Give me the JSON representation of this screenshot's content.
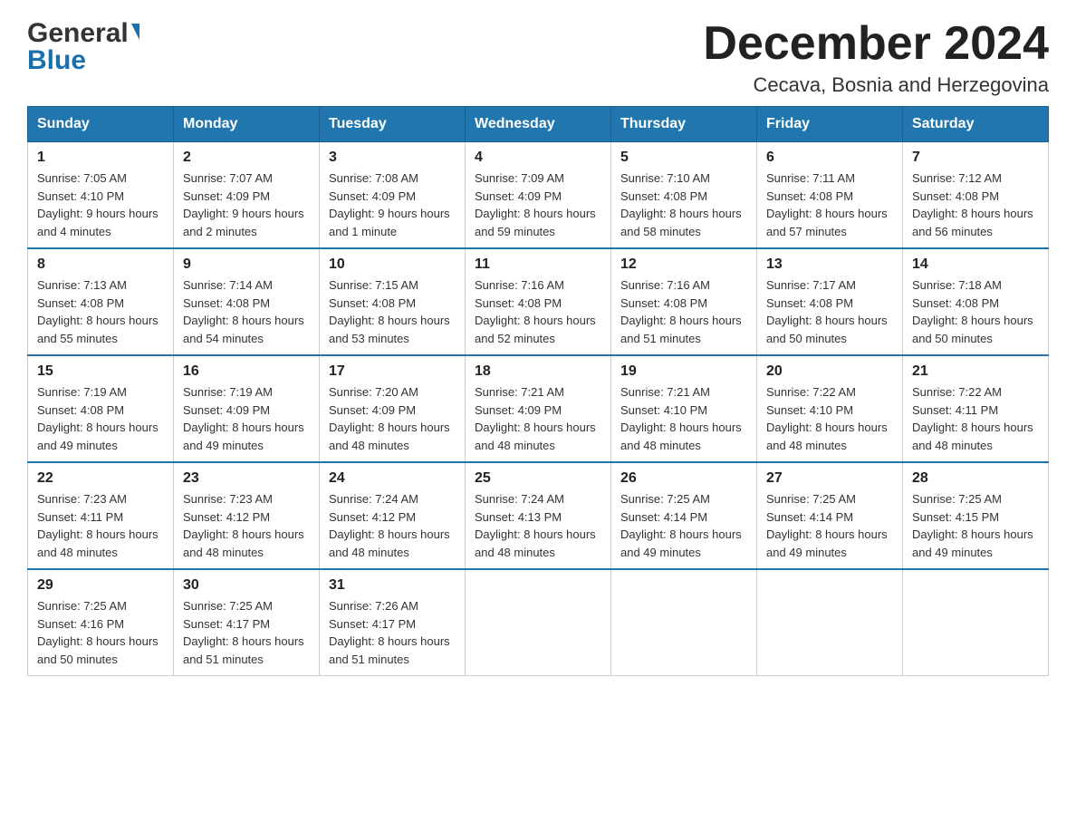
{
  "logo": {
    "general": "General",
    "blue": "Blue"
  },
  "title": {
    "month_year": "December 2024",
    "location": "Cecava, Bosnia and Herzegovina"
  },
  "weekdays": [
    "Sunday",
    "Monday",
    "Tuesday",
    "Wednesday",
    "Thursday",
    "Friday",
    "Saturday"
  ],
  "weeks": [
    [
      {
        "day": "1",
        "sunrise": "7:05 AM",
        "sunset": "4:10 PM",
        "daylight": "9 hours and 4 minutes."
      },
      {
        "day": "2",
        "sunrise": "7:07 AM",
        "sunset": "4:09 PM",
        "daylight": "9 hours and 2 minutes."
      },
      {
        "day": "3",
        "sunrise": "7:08 AM",
        "sunset": "4:09 PM",
        "daylight": "9 hours and 1 minute."
      },
      {
        "day": "4",
        "sunrise": "7:09 AM",
        "sunset": "4:09 PM",
        "daylight": "8 hours and 59 minutes."
      },
      {
        "day": "5",
        "sunrise": "7:10 AM",
        "sunset": "4:08 PM",
        "daylight": "8 hours and 58 minutes."
      },
      {
        "day": "6",
        "sunrise": "7:11 AM",
        "sunset": "4:08 PM",
        "daylight": "8 hours and 57 minutes."
      },
      {
        "day": "7",
        "sunrise": "7:12 AM",
        "sunset": "4:08 PM",
        "daylight": "8 hours and 56 minutes."
      }
    ],
    [
      {
        "day": "8",
        "sunrise": "7:13 AM",
        "sunset": "4:08 PM",
        "daylight": "8 hours and 55 minutes."
      },
      {
        "day": "9",
        "sunrise": "7:14 AM",
        "sunset": "4:08 PM",
        "daylight": "8 hours and 54 minutes."
      },
      {
        "day": "10",
        "sunrise": "7:15 AM",
        "sunset": "4:08 PM",
        "daylight": "8 hours and 53 minutes."
      },
      {
        "day": "11",
        "sunrise": "7:16 AM",
        "sunset": "4:08 PM",
        "daylight": "8 hours and 52 minutes."
      },
      {
        "day": "12",
        "sunrise": "7:16 AM",
        "sunset": "4:08 PM",
        "daylight": "8 hours and 51 minutes."
      },
      {
        "day": "13",
        "sunrise": "7:17 AM",
        "sunset": "4:08 PM",
        "daylight": "8 hours and 50 minutes."
      },
      {
        "day": "14",
        "sunrise": "7:18 AM",
        "sunset": "4:08 PM",
        "daylight": "8 hours and 50 minutes."
      }
    ],
    [
      {
        "day": "15",
        "sunrise": "7:19 AM",
        "sunset": "4:08 PM",
        "daylight": "8 hours and 49 minutes."
      },
      {
        "day": "16",
        "sunrise": "7:19 AM",
        "sunset": "4:09 PM",
        "daylight": "8 hours and 49 minutes."
      },
      {
        "day": "17",
        "sunrise": "7:20 AM",
        "sunset": "4:09 PM",
        "daylight": "8 hours and 48 minutes."
      },
      {
        "day": "18",
        "sunrise": "7:21 AM",
        "sunset": "4:09 PM",
        "daylight": "8 hours and 48 minutes."
      },
      {
        "day": "19",
        "sunrise": "7:21 AM",
        "sunset": "4:10 PM",
        "daylight": "8 hours and 48 minutes."
      },
      {
        "day": "20",
        "sunrise": "7:22 AM",
        "sunset": "4:10 PM",
        "daylight": "8 hours and 48 minutes."
      },
      {
        "day": "21",
        "sunrise": "7:22 AM",
        "sunset": "4:11 PM",
        "daylight": "8 hours and 48 minutes."
      }
    ],
    [
      {
        "day": "22",
        "sunrise": "7:23 AM",
        "sunset": "4:11 PM",
        "daylight": "8 hours and 48 minutes."
      },
      {
        "day": "23",
        "sunrise": "7:23 AM",
        "sunset": "4:12 PM",
        "daylight": "8 hours and 48 minutes."
      },
      {
        "day": "24",
        "sunrise": "7:24 AM",
        "sunset": "4:12 PM",
        "daylight": "8 hours and 48 minutes."
      },
      {
        "day": "25",
        "sunrise": "7:24 AM",
        "sunset": "4:13 PM",
        "daylight": "8 hours and 48 minutes."
      },
      {
        "day": "26",
        "sunrise": "7:25 AM",
        "sunset": "4:14 PM",
        "daylight": "8 hours and 49 minutes."
      },
      {
        "day": "27",
        "sunrise": "7:25 AM",
        "sunset": "4:14 PM",
        "daylight": "8 hours and 49 minutes."
      },
      {
        "day": "28",
        "sunrise": "7:25 AM",
        "sunset": "4:15 PM",
        "daylight": "8 hours and 49 minutes."
      }
    ],
    [
      {
        "day": "29",
        "sunrise": "7:25 AM",
        "sunset": "4:16 PM",
        "daylight": "8 hours and 50 minutes."
      },
      {
        "day": "30",
        "sunrise": "7:25 AM",
        "sunset": "4:17 PM",
        "daylight": "8 hours and 51 minutes."
      },
      {
        "day": "31",
        "sunrise": "7:26 AM",
        "sunset": "4:17 PM",
        "daylight": "8 hours and 51 minutes."
      },
      null,
      null,
      null,
      null
    ]
  ],
  "labels": {
    "sunrise": "Sunrise:",
    "sunset": "Sunset:",
    "daylight": "Daylight:"
  }
}
